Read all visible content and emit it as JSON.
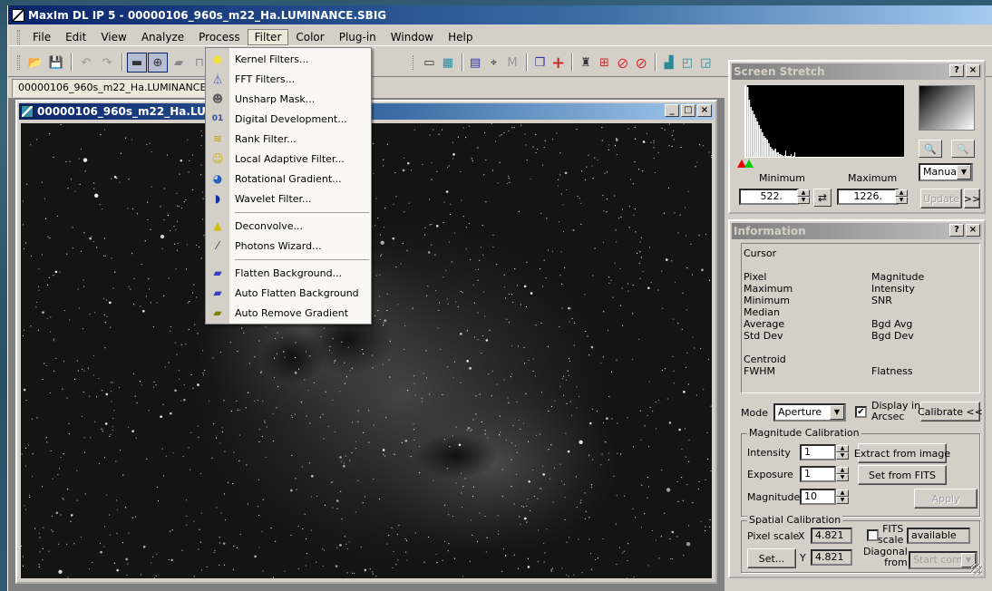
{
  "app": {
    "title": "MaxIm DL IP 5 - 00000106_960s_m22_Ha.LUMINANCE.SBIG"
  },
  "menubar": {
    "items": [
      "File",
      "Edit",
      "View",
      "Analyze",
      "Process",
      "Filter",
      "Color",
      "Plug-in",
      "Window",
      "Help"
    ],
    "active": "Filter"
  },
  "toolbar": {
    "buttons": [
      {
        "name": "open-icon",
        "glyph": "📂"
      },
      {
        "name": "save-icon",
        "glyph": "💾"
      },
      {
        "name": "undo-icon",
        "glyph": "↶"
      },
      {
        "name": "redo-icon",
        "glyph": "↷"
      },
      {
        "name": "screen-stretch-icon",
        "glyph": "▬"
      },
      {
        "name": "information-icon",
        "glyph": "⊕"
      },
      {
        "name": "camera-icon",
        "glyph": "▰"
      },
      {
        "name": "lock-icon",
        "glyph": "⊓"
      }
    ],
    "right_buttons": [
      {
        "name": "ruler-icon",
        "glyph": "▭"
      },
      {
        "name": "multi-ruler-icon",
        "glyph": "▦"
      },
      {
        "name": "measure-doc-icon",
        "glyph": "▤"
      },
      {
        "name": "point-measure-icon",
        "glyph": "⌖"
      },
      {
        "name": "m-ruler-icon",
        "glyph": "M"
      },
      {
        "name": "copy-icon",
        "glyph": "❐"
      },
      {
        "name": "crosshair-icon",
        "glyph": "+"
      },
      {
        "name": "brush-icon",
        "glyph": "♜"
      },
      {
        "name": "crop-icon",
        "glyph": "⊞"
      },
      {
        "name": "no-stripes-icon",
        "glyph": "⊘"
      },
      {
        "name": "no-corner-icon",
        "glyph": "⊘"
      },
      {
        "name": "graph-icon",
        "glyph": "▟"
      },
      {
        "name": "cascade-icon",
        "glyph": "◰"
      },
      {
        "name": "tile-icon",
        "glyph": "◲"
      }
    ]
  },
  "doc_tab": {
    "label": "00000106_960s_m22_Ha.LUMINANCE.SBIG"
  },
  "image_window": {
    "title": "00000106_960s_m22_Ha.LUMINANCE.SBIG",
    "minimize": "_",
    "maximize": "□",
    "close": "×"
  },
  "filter_menu": {
    "items": [
      {
        "label": "Kernel Filters...",
        "icon": "kernel-filter-icon",
        "glyph": "●",
        "color": "#f0e040"
      },
      {
        "label": "FFT Filters...",
        "icon": "fft-filter-icon",
        "glyph": "⏃",
        "color": "#3050d0"
      },
      {
        "label": "Unsharp Mask...",
        "icon": "unsharp-mask-icon",
        "glyph": "☻",
        "color": "#606060"
      },
      {
        "label": "Digital Development...",
        "icon": "digital-development-icon",
        "glyph": "01",
        "color": "#3050a0"
      },
      {
        "label": "Rank Filter...",
        "icon": "rank-filter-icon",
        "glyph": "≋",
        "color": "#c0a000"
      },
      {
        "label": "Local Adaptive Filter...",
        "icon": "local-adaptive-filter-icon",
        "glyph": "☺",
        "color": "#d0b000"
      },
      {
        "label": "Rotational Gradient...",
        "icon": "rotational-gradient-icon",
        "glyph": "◕",
        "color": "#2060c0"
      },
      {
        "label": "Wavelet Filter...",
        "icon": "wavelet-filter-icon",
        "glyph": "◗",
        "color": "#1030a0"
      },
      {
        "separator": true
      },
      {
        "label": "Deconvolve...",
        "icon": "deconvolve-icon",
        "glyph": "▲",
        "color": "#d0c000"
      },
      {
        "label": "Photons Wizard...",
        "icon": "photons-wizard-icon",
        "glyph": "⁄",
        "color": "#404040"
      },
      {
        "separator": true
      },
      {
        "label": "Flatten Background...",
        "icon": "flatten-background-icon",
        "glyph": "▰",
        "color": "#3040c0"
      },
      {
        "label": "Auto Flatten Background",
        "icon": "auto-flatten-background-icon",
        "glyph": "▰",
        "color": "#3040c0"
      },
      {
        "label": "Auto Remove Gradient",
        "icon": "auto-remove-gradient-icon",
        "glyph": "▰",
        "color": "#808000"
      }
    ]
  },
  "screen_stretch": {
    "title": "Screen Stretch",
    "help": "?",
    "close": "×",
    "minimum_label": "Minimum",
    "maximum_label": "Maximum",
    "minimum_value": "522.",
    "maximum_value": "1226.",
    "mode_value": "Manual",
    "update_label": "Update",
    "expand_label": ">>",
    "swap_glyph": "⇄",
    "zoom_in_glyph": "🔍",
    "zoom_out_glyph": "🔍"
  },
  "information": {
    "title": "Information",
    "help": "?",
    "close": "×",
    "cursor_label": "Cursor",
    "left_labels": [
      "Pixel",
      "Maximum",
      "Minimum",
      "Median",
      "Average",
      "Std Dev"
    ],
    "right_labels": [
      "Magnitude",
      "Intensity",
      "SNR",
      "",
      "Bgd Avg",
      "Bgd Dev"
    ],
    "centroid_label": "Centroid",
    "fwhm_label": "FWHM",
    "flatness_label": "Flatness",
    "mode_label": "Mode",
    "mode_value": "Aperture",
    "display_arcsec_label_1": "Display in",
    "display_arcsec_label_2": "Arcsec",
    "display_arcsec_checked": true,
    "calibrate_label": "Calibrate <<",
    "magnitude_calibration": {
      "title": "Magnitude Calibration",
      "intensity_label": "Intensity",
      "intensity_value": "1",
      "exposure_label": "Exposure",
      "exposure_value": "1",
      "magnitude_label": "Magnitude",
      "magnitude_value": "10",
      "extract_label": "Extract from image",
      "set_fits_label": "Set from FITS",
      "apply_label": "Apply"
    },
    "spatial_calibration": {
      "title": "Spatial Calibration",
      "pixel_scale_label": "Pixel scale",
      "x_label": "X",
      "y_label": "Y",
      "x_value": "4.821",
      "y_value": "4.821",
      "fits_label_1": "FITS",
      "fits_label_2": "scale",
      "fits_checked": false,
      "fits_status": "available",
      "diagonal_label_1": "Diagonal",
      "diagonal_label_2": "from",
      "diagonal_value": "Start corner",
      "set_label": "Set..."
    }
  }
}
